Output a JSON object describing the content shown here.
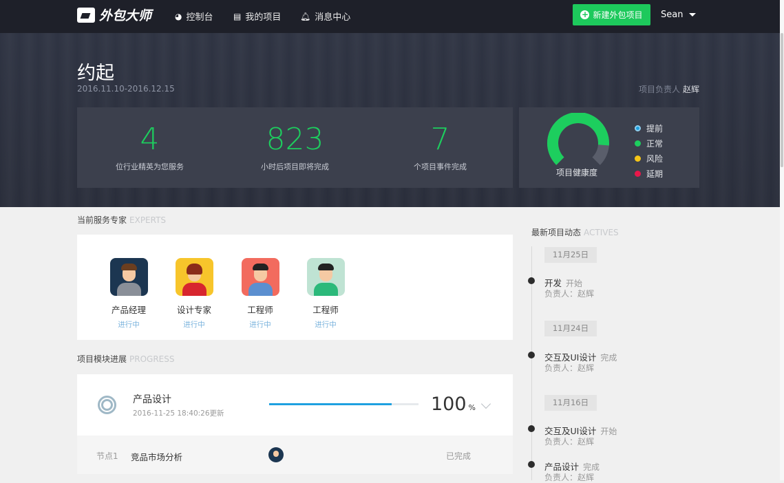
{
  "nav": {
    "logo_text": "外包大师",
    "items": [
      {
        "label": "控制台",
        "icon": "dashboard-icon"
      },
      {
        "label": "我的项目",
        "icon": "list-icon"
      },
      {
        "label": "消息中心",
        "icon": "bell-icon"
      }
    ],
    "new_project_label": "新建外包项目",
    "user_name": "Sean"
  },
  "project": {
    "title": "约起",
    "date_range": "2016.11.10-2016.12.15",
    "owner_label": "项目负责人",
    "owner_name": "赵辉",
    "stats": [
      {
        "value": "4",
        "label": "位行业精英为您服务"
      },
      {
        "value": "823",
        "label": "小时后项目即将完成"
      },
      {
        "value": "7",
        "label": "个项目事件完成"
      }
    ],
    "health": {
      "label": "项目健康度",
      "level": 0.85,
      "legend": [
        {
          "label": "提前",
          "color": "#1ea0e0"
        },
        {
          "label": "正常",
          "color": "#1dce5e"
        },
        {
          "label": "风险",
          "color": "#f5c518"
        },
        {
          "label": "延期",
          "color": "#e8174a"
        }
      ]
    }
  },
  "experts": {
    "title": "当前服务专家",
    "title_en": "EXPERTS",
    "list": [
      {
        "role": "产品经理",
        "status": "进行中"
      },
      {
        "role": "设计专家",
        "status": "进行中"
      },
      {
        "role": "工程师",
        "status": "进行中"
      },
      {
        "role": "工程师",
        "status": "进行中"
      }
    ]
  },
  "progress": {
    "title": "项目模块进展",
    "title_en": "PROGRESS",
    "module": {
      "name": "产品设计",
      "updated": "2016-11-25 18:40:26更新",
      "percent": "100",
      "percent_unit": "%",
      "bar_fill": 0.82
    },
    "node": {
      "index": "节点1",
      "name": "竞品市场分析",
      "status": "已完成"
    }
  },
  "activity": {
    "title": "最新项目动态",
    "title_en": "ACTIVES",
    "dates": [
      "11月25日",
      "11月24日",
      "11月16日"
    ],
    "events": [
      {
        "title": "开发",
        "state": "开始",
        "owner": "负责人：赵辉"
      },
      {
        "title": "交互及UI设计",
        "state": "完成",
        "owner": "负责人：赵辉"
      },
      {
        "title": "交互及UI设计",
        "state": "开始",
        "owner": "负责人：赵辉"
      },
      {
        "title": "产品设计",
        "state": "完成",
        "owner": "负责人：赵辉"
      }
    ]
  }
}
